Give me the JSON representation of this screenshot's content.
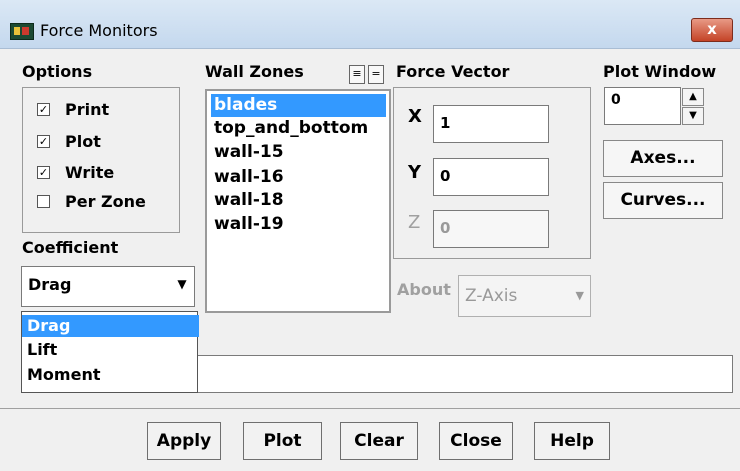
{
  "window": {
    "title": "Force Monitors",
    "close_label": "x"
  },
  "options": {
    "label": "Options",
    "items": [
      {
        "label": "Print",
        "checked": true,
        "mark": "☑"
      },
      {
        "label": "Plot",
        "checked": true,
        "mark": "☑"
      },
      {
        "label": "Write",
        "checked": true,
        "mark": "☑"
      },
      {
        "label": "Per Zone",
        "checked": false,
        "mark": ""
      }
    ]
  },
  "coefficient": {
    "label": "Coefficient",
    "value": "Drag",
    "options": [
      "Drag",
      "Lift",
      "Moment"
    ],
    "selected_option": "Drag"
  },
  "wall_zones": {
    "label": "Wall Zones",
    "items": [
      "blades",
      "top_and_bottom",
      "wall-15",
      "wall-16",
      "wall-18",
      "wall-19"
    ],
    "selected": "blades"
  },
  "force_vector": {
    "label": "Force Vector",
    "x_label": "X",
    "x_value": "1",
    "y_label": "Y",
    "y_value": "0",
    "z_label": "Z",
    "z_value": "0"
  },
  "about": {
    "label": "About",
    "value": "Z-Axis"
  },
  "plot_window": {
    "label": "Plot Window",
    "value": "0",
    "axes_label": "Axes...",
    "curves_label": "Curves..."
  },
  "buttons": {
    "apply": "Apply",
    "plot": "Plot",
    "clear": "Clear",
    "close": "Close",
    "help": "Help"
  },
  "icons": {
    "app": "fluent-app-icon",
    "close": "close-icon",
    "dropdown": "chevron-down-icon"
  },
  "colors": {
    "selection": "#3399ff",
    "close_button": "#c44327"
  }
}
